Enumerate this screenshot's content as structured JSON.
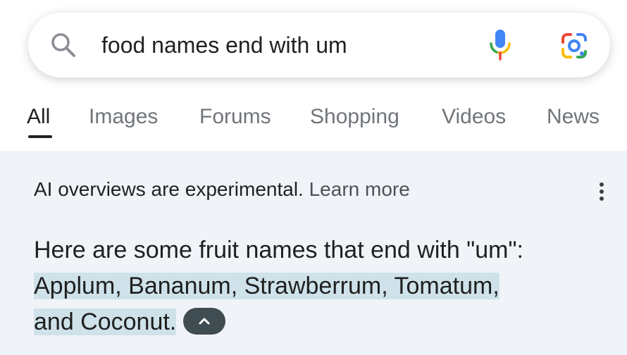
{
  "search": {
    "query": "food names end with um",
    "search_icon": "search-icon",
    "mic_icon": "microphone-icon",
    "lens_icon": "google-lens-icon"
  },
  "tabs": [
    {
      "label": "All",
      "active": true
    },
    {
      "label": "Images",
      "active": false
    },
    {
      "label": "Forums",
      "active": false
    },
    {
      "label": "Shopping",
      "active": false
    },
    {
      "label": "Videos",
      "active": false
    },
    {
      "label": "News",
      "active": false
    }
  ],
  "overview": {
    "notice": "AI overviews are experimental.",
    "learn_more": "Learn more",
    "menu_icon": "more-vert-icon",
    "answer_intro": "Here are some fruit names that end with \"um\":",
    "answer_highlight_1": "Applum, Bananum, Strawberrum, Tomatum,",
    "answer_highlight_2": "and Coconut.",
    "collapse_icon": "chevron-up-icon"
  },
  "colors": {
    "google_blue": "#4285F4",
    "google_red": "#EA4335",
    "google_yellow": "#FBBC05",
    "google_green": "#34A853",
    "overview_bg": "#f0f4f9",
    "highlight": "#cfe2ea"
  }
}
